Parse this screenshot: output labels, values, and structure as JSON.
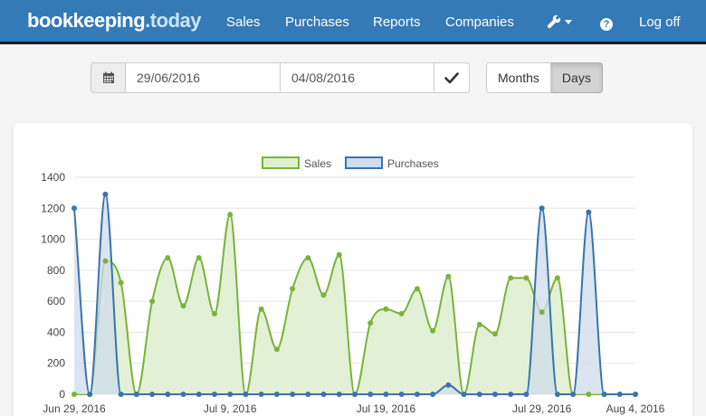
{
  "brand": {
    "name": "bookkeeping",
    "suffix": ".today"
  },
  "nav": {
    "sales": "Sales",
    "purchases": "Purchases",
    "reports": "Reports",
    "companies": "Companies",
    "help_symbol": "?",
    "logoff": "Log off"
  },
  "icons": {
    "settings": "wrench-icon",
    "calendar": "calendar-icon",
    "apply": "checkmark-icon",
    "help": "question-circle-icon"
  },
  "filter": {
    "date_from": "29/06/2016",
    "date_to": "04/08/2016",
    "modes": [
      "Months",
      "Days"
    ],
    "active_mode": "Days"
  },
  "colors": {
    "navbar": "#337ab7",
    "sales_line": "#7bb339",
    "sales_fill": "#dff0d0",
    "purchases_line": "#3a74ad",
    "purchases_fill": "#cfdcec"
  },
  "chart_data": {
    "type": "area",
    "legend_position": "top",
    "grid": true,
    "ylim": [
      0,
      1400
    ],
    "yticks": [
      0,
      200,
      400,
      600,
      800,
      1000,
      1200,
      1400
    ],
    "xlim": [
      "2016-06-29",
      "2016-08-04"
    ],
    "xticks": [
      "Jun 29, 2016",
      "Jul 9, 2016",
      "Jul 19, 2016",
      "Jul 29, 2016",
      "Aug 4, 2016"
    ],
    "x": [
      "2016-06-29",
      "2016-06-30",
      "2016-07-01",
      "2016-07-02",
      "2016-07-03",
      "2016-07-04",
      "2016-07-05",
      "2016-07-06",
      "2016-07-07",
      "2016-07-08",
      "2016-07-09",
      "2016-07-10",
      "2016-07-11",
      "2016-07-12",
      "2016-07-13",
      "2016-07-14",
      "2016-07-15",
      "2016-07-16",
      "2016-07-17",
      "2016-07-18",
      "2016-07-19",
      "2016-07-20",
      "2016-07-21",
      "2016-07-22",
      "2016-07-23",
      "2016-07-24",
      "2016-07-25",
      "2016-07-26",
      "2016-07-27",
      "2016-07-28",
      "2016-07-29",
      "2016-07-30",
      "2016-07-31",
      "2016-08-01",
      "2016-08-02",
      "2016-08-03",
      "2016-08-04"
    ],
    "series": [
      {
        "name": "Sales",
        "values": [
          0,
          0,
          860,
          720,
          0,
          600,
          880,
          570,
          880,
          520,
          1160,
          0,
          550,
          290,
          680,
          880,
          640,
          900,
          0,
          460,
          550,
          520,
          680,
          410,
          760,
          0,
          450,
          390,
          750,
          750,
          530,
          750,
          0,
          0,
          0,
          0,
          0
        ]
      },
      {
        "name": "Purchases",
        "values": [
          1200,
          0,
          1290,
          0,
          0,
          0,
          0,
          0,
          0,
          0,
          0,
          0,
          0,
          0,
          0,
          0,
          0,
          0,
          0,
          0,
          0,
          0,
          0,
          0,
          60,
          0,
          0,
          0,
          0,
          0,
          1200,
          0,
          0,
          1175,
          0,
          0,
          0
        ]
      }
    ]
  }
}
